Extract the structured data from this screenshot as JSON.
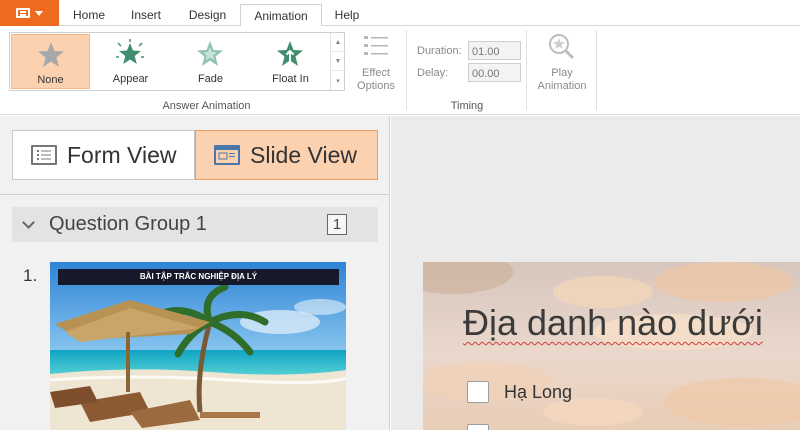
{
  "tabs": [
    "Home",
    "Insert",
    "Design",
    "Animation",
    "Help"
  ],
  "active_tab": "Animation",
  "ribbon": {
    "animations": [
      "None",
      "Appear",
      "Fade",
      "Float In"
    ],
    "selected_animation": "None",
    "group_answer_animation": "Answer Animation",
    "effect_options": "Effect Options",
    "duration_label": "Duration:",
    "duration_value": "01.00",
    "delay_label": "Delay:",
    "delay_value": "00.00",
    "group_timing": "Timing",
    "play_animation": "Play Animation"
  },
  "left_pane": {
    "form_view": "Form View",
    "slide_view": "Slide View",
    "group_title": "Question Group 1",
    "group_count": "1",
    "slide_number": "1.",
    "thumb_title": "BÀI TẬP TRẮC NGHIỆP ĐỊA LÝ"
  },
  "slide": {
    "question": "Địa danh nào dưới",
    "option_a": "Hạ Long"
  },
  "colors": {
    "accent": "#ee6a1f",
    "selected_fill": "#fcd1b0",
    "icon_green": "#3f8f6e"
  }
}
